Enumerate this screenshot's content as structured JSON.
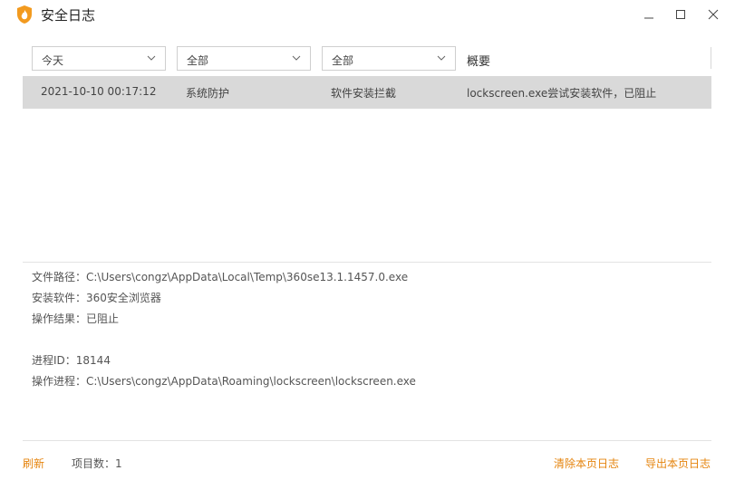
{
  "window": {
    "title": "安全日志",
    "icons": {
      "app": "360-flame-shield-icon",
      "minimize": "minimize-icon",
      "maximize": "maximize-icon",
      "close": "close-icon"
    }
  },
  "filters": {
    "date": "今天",
    "type": "全部",
    "action": "全部",
    "summary_header": "概要"
  },
  "table": {
    "rows": [
      {
        "time": "2021-10-10 00:17:12",
        "category": "系统防护",
        "event": "软件安装拦截",
        "summary": "lockscreen.exe尝试安装软件，已阻止"
      }
    ]
  },
  "details": {
    "file_path": "文件路径：C:\\Users\\congz\\AppData\\Local\\Temp\\360se13.1.1457.0.exe",
    "software": "安装软件：360安全浏览器",
    "result": "操作结果：已阻止",
    "pid": "进程ID：18144",
    "process": "操作进程：C:\\Users\\congz\\AppData\\Roaming\\lockscreen\\lockscreen.exe"
  },
  "footer": {
    "refresh": "刷新",
    "item_count": "项目数：1",
    "clear": "清除本页日志",
    "export": "导出本页日志"
  },
  "colors": {
    "accent": "#e5840e",
    "selected_row": "#d9d9d9"
  }
}
